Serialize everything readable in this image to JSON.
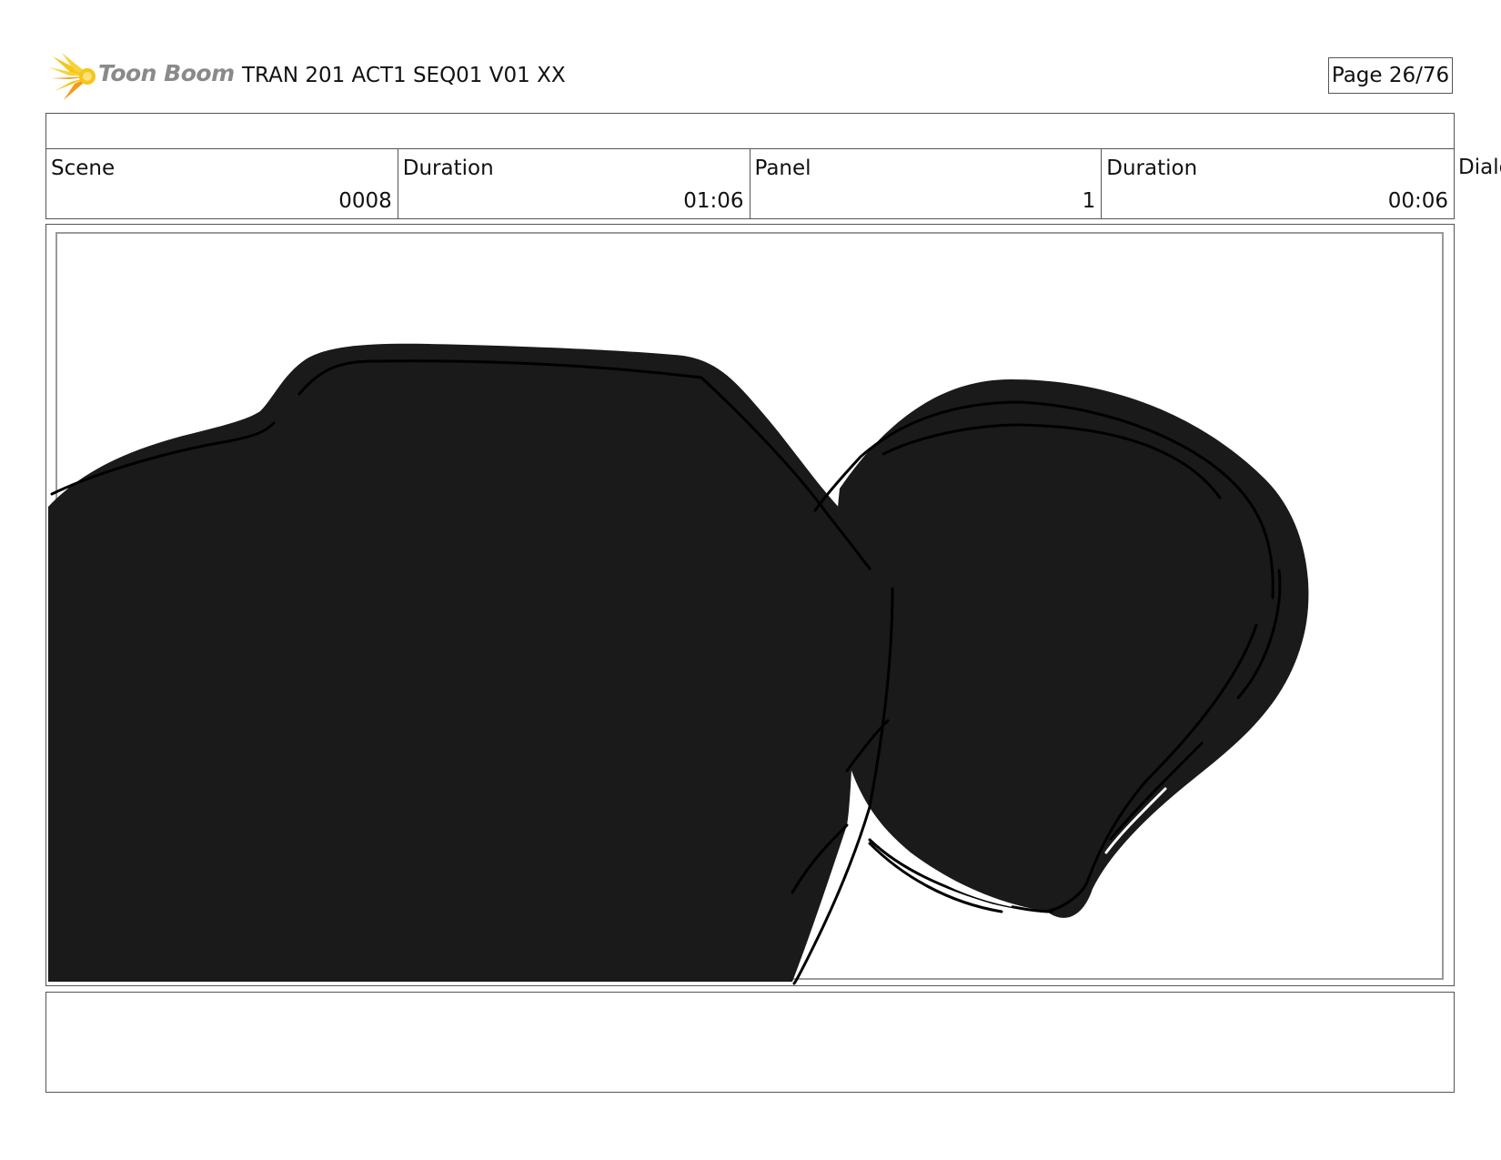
{
  "header": {
    "logo_text": "Toon Boom",
    "doc_title": "TRAN 201 ACT1 SEQ01 V01 XX",
    "page_label": "Page 26/76"
  },
  "info": {
    "cells": [
      {
        "label": "Scene",
        "value": "0008"
      },
      {
        "label": "Duration",
        "value": "01:06"
      },
      {
        "label": "Panel",
        "value": "1"
      },
      {
        "label": "Duration",
        "value": "00:06"
      }
    ],
    "dialog_label": "Dialog"
  },
  "colors": {
    "logo_yellow": "#f5c518",
    "logo_orange": "#f39a1c",
    "logo_text": "#8a8a8a",
    "silhouette": "#1a1a1a",
    "border": "#555555"
  },
  "icons": {
    "logo": "toon-boom-burst-icon"
  }
}
